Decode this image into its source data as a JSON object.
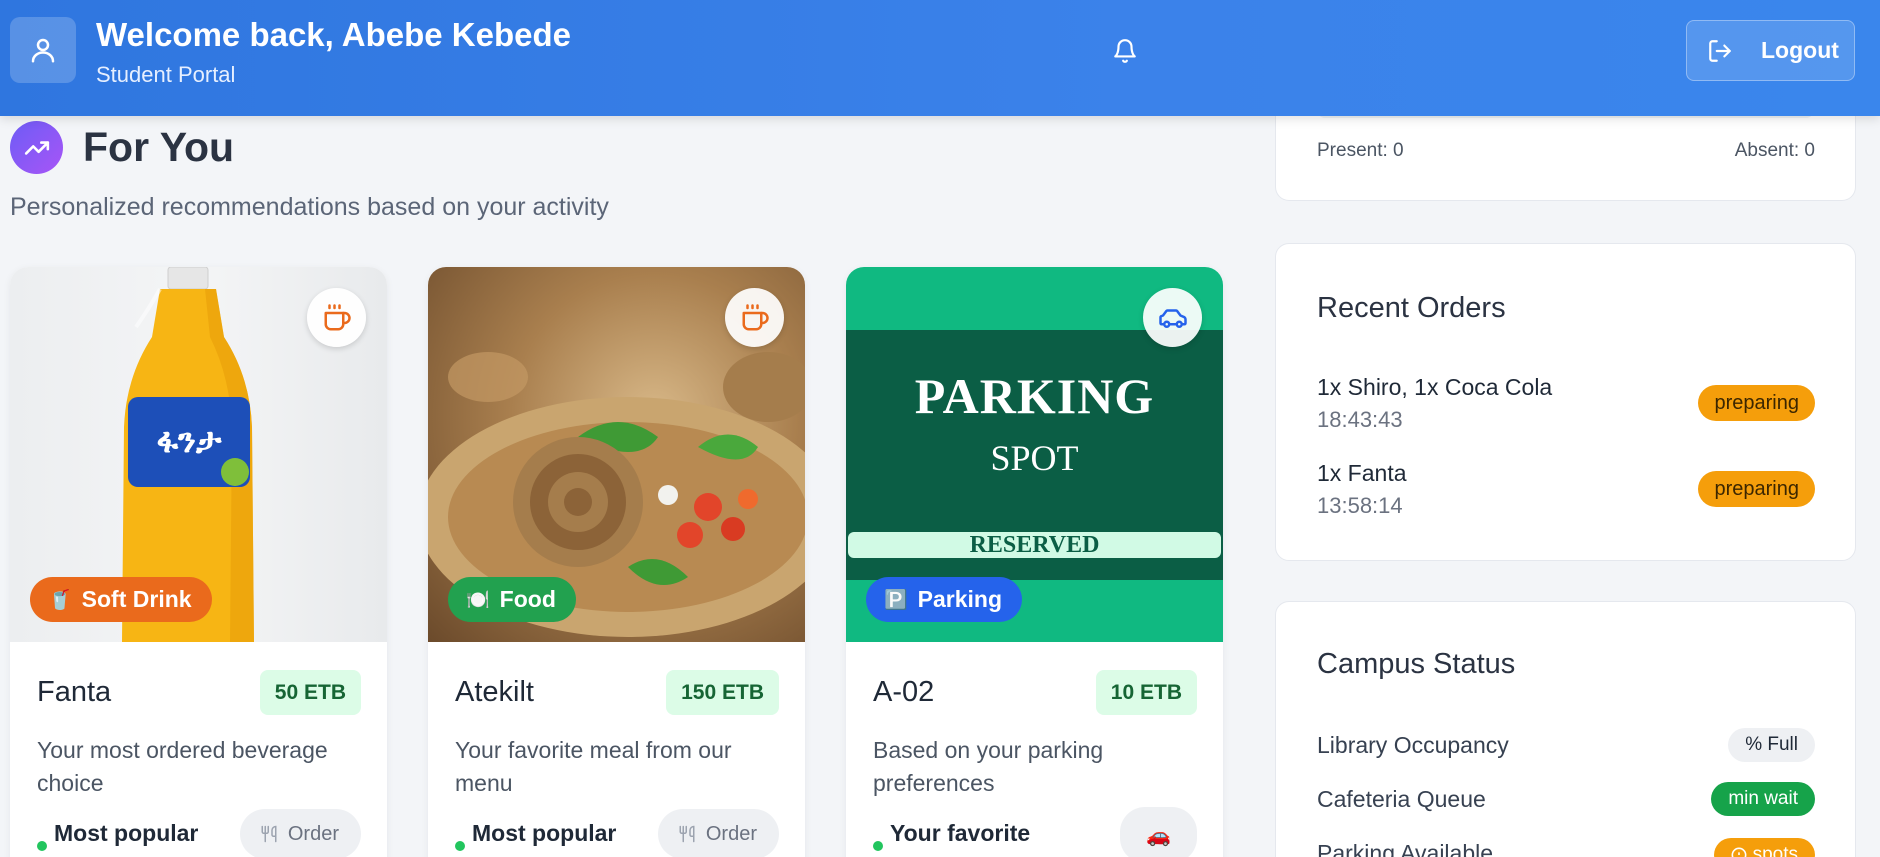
{
  "header": {
    "welcome": "Welcome back, Abebe Kebede",
    "portal": "Student Portal",
    "logout_label": "Logout",
    "icons": [
      "user-icon",
      "bell-icon",
      "logout-icon"
    ]
  },
  "for_you": {
    "title": "For You",
    "subtitle": "Personalized recommendations based on your activity",
    "cards": [
      {
        "category": "Soft Drink",
        "category_icon": "🥤",
        "category_color": "#ea6a1c",
        "corner_icon": "coffee-icon",
        "name": "Fanta",
        "price": "50 ETB",
        "description": "Your most ordered beverage choice",
        "tag": "Most popular",
        "action": "Order"
      },
      {
        "category": "Food",
        "category_icon": "🍽️",
        "category_color": "#22a14f",
        "corner_icon": "coffee-icon",
        "name": "Atekilt",
        "price": "150 ETB",
        "description": "Your favorite meal from our menu",
        "tag": "Most popular",
        "action": "Order"
      },
      {
        "category": "Parking",
        "category_icon": "🅿️",
        "category_color": "#2563eb",
        "corner_icon": "car-icon",
        "name": "A-02",
        "price": "10 ETB",
        "description": "Based on your parking preferences",
        "tag": "Your favorite",
        "action": "🚗",
        "image_text": {
          "title": "PARKING",
          "spot": "SPOT",
          "reserved": "RESERVED"
        }
      }
    ]
  },
  "attendance": {
    "present": "Present: 0",
    "absent": "Absent: 0"
  },
  "recent_orders": {
    "title": "Recent Orders",
    "items": [
      {
        "item": "1x Shiro, 1x Coca Cola",
        "time": "18:43:43",
        "status": "preparing"
      },
      {
        "item": "1x Fanta",
        "time": "13:58:14",
        "status": "preparing"
      }
    ]
  },
  "campus_status": {
    "title": "Campus Status",
    "rows": [
      {
        "label": "Library Occupancy",
        "value": "% Full",
        "bg": "#eef0f3",
        "fg": "#1f2937"
      },
      {
        "label": "Cafeteria Queue",
        "value": "min wait",
        "bg": "#16a34a",
        "fg": "#ffffff"
      },
      {
        "label": "Parking Available",
        "value": "spots",
        "bg": "#f59e0b",
        "fg": "#ffffff"
      }
    ]
  }
}
